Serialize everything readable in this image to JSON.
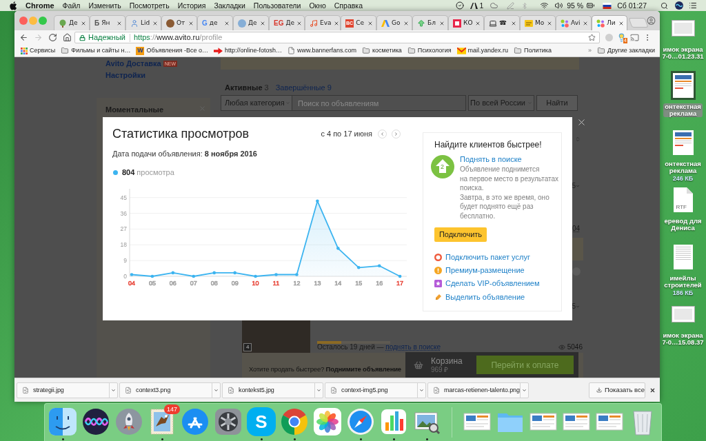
{
  "menu_bar": {
    "app": "Chrome",
    "items": [
      "Файл",
      "Изменить",
      "Посмотреть",
      "История",
      "Закладки",
      "Пользователи",
      "Окно",
      "Справка"
    ],
    "adobe_count": "1",
    "battery": "95 %",
    "clock": "Сб 01:27"
  },
  "browser": {
    "tabs": [
      {
        "title": "Де",
        "favicon": {
          "kind": "plant"
        },
        "selected": false
      },
      {
        "title": "Ян",
        "favicon": {
          "kind": "letter",
          "text": "Б",
          "color": "#555555"
        },
        "selected": false
      },
      {
        "title": "Lid",
        "favicon": {
          "kind": "person"
        },
        "selected": false
      },
      {
        "title": "От",
        "favicon": {
          "kind": "disc",
          "color": "#8a5a33"
        },
        "selected": false
      },
      {
        "title": "де",
        "favicon": {
          "kind": "letter",
          "text": "G",
          "color": "#4285f4"
        },
        "selected": false
      },
      {
        "title": "Де",
        "favicon": {
          "kind": "disc",
          "color": "#86aed6"
        },
        "selected": false
      },
      {
        "title": "Де",
        "favicon": {
          "kind": "letter",
          "text": "EG",
          "color": "#d8352a"
        },
        "selected": false
      },
      {
        "title": "Eva",
        "favicon": {
          "kind": "note"
        },
        "selected": false
      },
      {
        "title": "Се",
        "favicon": {
          "kind": "tile",
          "text": "BC",
          "color": "#e0452f"
        },
        "selected": false
      },
      {
        "title": "Go",
        "favicon": {
          "kind": "triangle"
        },
        "selected": false
      },
      {
        "title": "Бл",
        "favicon": {
          "kind": "arrow"
        },
        "selected": false
      },
      {
        "title": "КО",
        "favicon": {
          "kind": "square",
          "color": "#e8264a"
        },
        "selected": false
      },
      {
        "title": "☎",
        "favicon": {
          "kind": "laptop"
        },
        "selected": false
      },
      {
        "title": "Мо",
        "favicon": {
          "kind": "sticky"
        },
        "selected": false
      },
      {
        "title": "Avi",
        "favicon": {
          "kind": "dots"
        },
        "selected": false
      },
      {
        "title": "Ли",
        "favicon": {
          "kind": "dots"
        },
        "selected": true
      }
    ],
    "address_bar": {
      "security": "Надежный",
      "url": {
        "scheme": "https",
        "separator": "://",
        "host": "www.avito.ru",
        "path": "/profile"
      }
    },
    "extension_badge": "4",
    "bookmarks": [
      {
        "kind": "apps",
        "label": "Сервисы"
      },
      {
        "kind": "folder",
        "label": "Фильмы и сайты н…"
      },
      {
        "kind": "site",
        "icon_text": "W",
        "label": "Объявления -Все о…"
      },
      {
        "kind": "arrow",
        "label": "http://online-fotosh…"
      },
      {
        "kind": "page",
        "label": "www.bannerfans.com"
      },
      {
        "kind": "folder",
        "label": "косметика"
      },
      {
        "kind": "folder",
        "label": "Психология"
      },
      {
        "kind": "mail",
        "label": "mail.yandex.ru"
      },
      {
        "kind": "folder",
        "label": "Политика"
      }
    ],
    "bookmarks_more": "»",
    "other_bookmarks": "Другие закладки"
  },
  "page": {
    "sidebar": {
      "links": [
        {
          "label": "Avito Доставка",
          "badge": "NEW"
        },
        {
          "label": "Настройки"
        }
      ],
      "notice_title": "Моментальные"
    },
    "listing_tabs": [
      {
        "label": "Активные",
        "count": "3",
        "selected": true
      },
      {
        "label": "Завершённые",
        "count": "9",
        "selected": false
      }
    ],
    "search": {
      "category": "Любая категория",
      "placeholder": "Поиск по объявлениям",
      "region": "По всей России",
      "button": "Найти"
    },
    "column_fragments": [
      {
        "kind": "select",
        "text": "5"
      },
      {
        "kind": "link",
        "text": "04"
      },
      {
        "kind": "select",
        "text": "5"
      }
    ],
    "listing": {
      "photo_count": "4",
      "level": 0.33,
      "status": "Осталось 19 дней —",
      "raise_link": "поднять в поиске",
      "views": "5046"
    },
    "sell_faster": "Хотите продать быстрее? **Поднимите объявление**",
    "cart": {
      "title": "Корзина",
      "total": "969 ₽",
      "button": "Перейти к оплате"
    }
  },
  "modal": {
    "title": "Статистика просмотров",
    "period": "с 4 по 17 июня",
    "posted": "Дата подачи объявления: **8 ноября 2016**",
    "legend": {
      "count": "804",
      "unit": "просмотра"
    },
    "chart": {
      "xtick_colors": [
        {
          "color": "#e8473b"
        },
        {
          "color": "#9e9e9e"
        },
        {
          "color": "#9e9e9e"
        },
        {
          "color": "#9e9e9e"
        },
        {
          "color": "#9e9e9e"
        },
        {
          "color": "#9e9e9e"
        },
        {
          "color": "#e8473b"
        },
        {
          "color": "#e8473b"
        },
        {
          "color": "#9e9e9e"
        },
        {
          "color": "#9e9e9e"
        },
        {
          "color": "#9e9e9e"
        },
        {
          "color": "#9e9e9e"
        },
        {
          "color": "#9e9e9e"
        },
        {
          "color": "#e8473b"
        }
      ],
      "chart_data": {
        "type": "area",
        "grid": true,
        "x": [
          4,
          5,
          6,
          7,
          8,
          9,
          10,
          11,
          12,
          13,
          14,
          15,
          16,
          17
        ],
        "series": [
          {
            "color": "#3cb4f0",
            "values": [
              1,
              0,
              2,
              0,
              2,
              2,
              0,
              1,
              1,
              43,
              16,
              5,
              6,
              0
            ]
          }
        ],
        "xlim": [
          3.9,
          17.33
        ],
        "ylim": [
          0,
          50
        ],
        "xticks": [
          {
            "value": 4,
            "label": "04"
          },
          {
            "value": 5,
            "label": "05"
          },
          {
            "value": 6,
            "label": "06"
          },
          {
            "value": 7,
            "label": "07"
          },
          {
            "value": 8,
            "label": "08"
          },
          {
            "value": 9,
            "label": "09"
          },
          {
            "value": 10,
            "label": "10"
          },
          {
            "value": 11,
            "label": "11"
          },
          {
            "value": 12,
            "label": "12"
          },
          {
            "value": 13,
            "label": "13"
          },
          {
            "value": 14,
            "label": "14"
          },
          {
            "value": 15,
            "label": "15"
          },
          {
            "value": 16,
            "label": "16"
          },
          {
            "value": 17,
            "label": "17"
          }
        ],
        "yticks": [
          0,
          9,
          18,
          27,
          36,
          45
        ]
      }
    },
    "promo": {
      "title": "Найдите клиентов быстрее!",
      "feature": {
        "icon_digit": "2",
        "link": "Поднять в поиске",
        "description": [
          "Объявление поднимется",
          "на первое место в результатах",
          "поиска.",
          "Завтра, в это же время, оно",
          "будет поднято ещё раз",
          "бесплатно."
        ]
      },
      "button": "Подключить",
      "services": [
        {
          "kind": "package",
          "label": "Подключить пакет услуг"
        },
        {
          "kind": "premium",
          "label": "Премиум-размещение"
        },
        {
          "kind": "vip",
          "label": "Сделать VIP-объявлением"
        },
        {
          "kind": "highlight",
          "label": "Выделить объявление"
        }
      ]
    }
  },
  "downloads": {
    "items": [
      "strategii.jpg",
      "context3.png",
      "kontekst5.jpg",
      "context-img5.png",
      "marcas-retienen-talento.png"
    ],
    "show_all": "Показать все"
  },
  "dock": {
    "apps": [
      {
        "kind": "finder",
        "running": true
      },
      {
        "kind": "siri",
        "running": false
      },
      {
        "kind": "launchpad",
        "running": false
      },
      {
        "kind": "mail",
        "running": true,
        "badge": "147"
      },
      {
        "kind": "appstore",
        "running": false
      },
      {
        "kind": "settings",
        "running": false
      },
      {
        "kind": "skype",
        "running": true,
        "glyph": "S"
      },
      {
        "kind": "chrome",
        "running": true
      },
      {
        "kind": "photos",
        "running": false
      },
      {
        "kind": "safari",
        "running": true
      },
      {
        "kind": "numbers",
        "running": true
      },
      {
        "kind": "preview",
        "running": true
      }
    ],
    "documents": [
      {
        "kind": "thumbnail"
      },
      {
        "kind": "folder"
      },
      {
        "kind": "thumbnail"
      },
      {
        "kind": "thumbnail"
      },
      {
        "kind": "thumbnail"
      },
      {
        "kind": "trash"
      }
    ]
  },
  "desktop_files": [
    {
      "kind": "screenshot",
      "lines": [
        "имок экрана",
        "7-0…01.23.31"
      ],
      "selected": false
    },
    {
      "kind": "document",
      "lines": [
        "онтекстная",
        "реклама"
      ],
      "selected": true
    },
    {
      "kind": "document",
      "lines": [
        "онтекстная",
        "реклама"
      ],
      "size": "246 КБ",
      "selected": false
    },
    {
      "kind": "rtf",
      "badge": "RTF",
      "lines": [
        "еревод для",
        "Дениса"
      ],
      "selected": false
    },
    {
      "kind": "sheet",
      "lines": [
        "имейлы",
        "строителей"
      ],
      "size": "186 КБ",
      "selected": false
    },
    {
      "kind": "screenshot",
      "lines": [
        "имок экрана",
        "7-0…15.08.37"
      ],
      "selected": false
    }
  ]
}
